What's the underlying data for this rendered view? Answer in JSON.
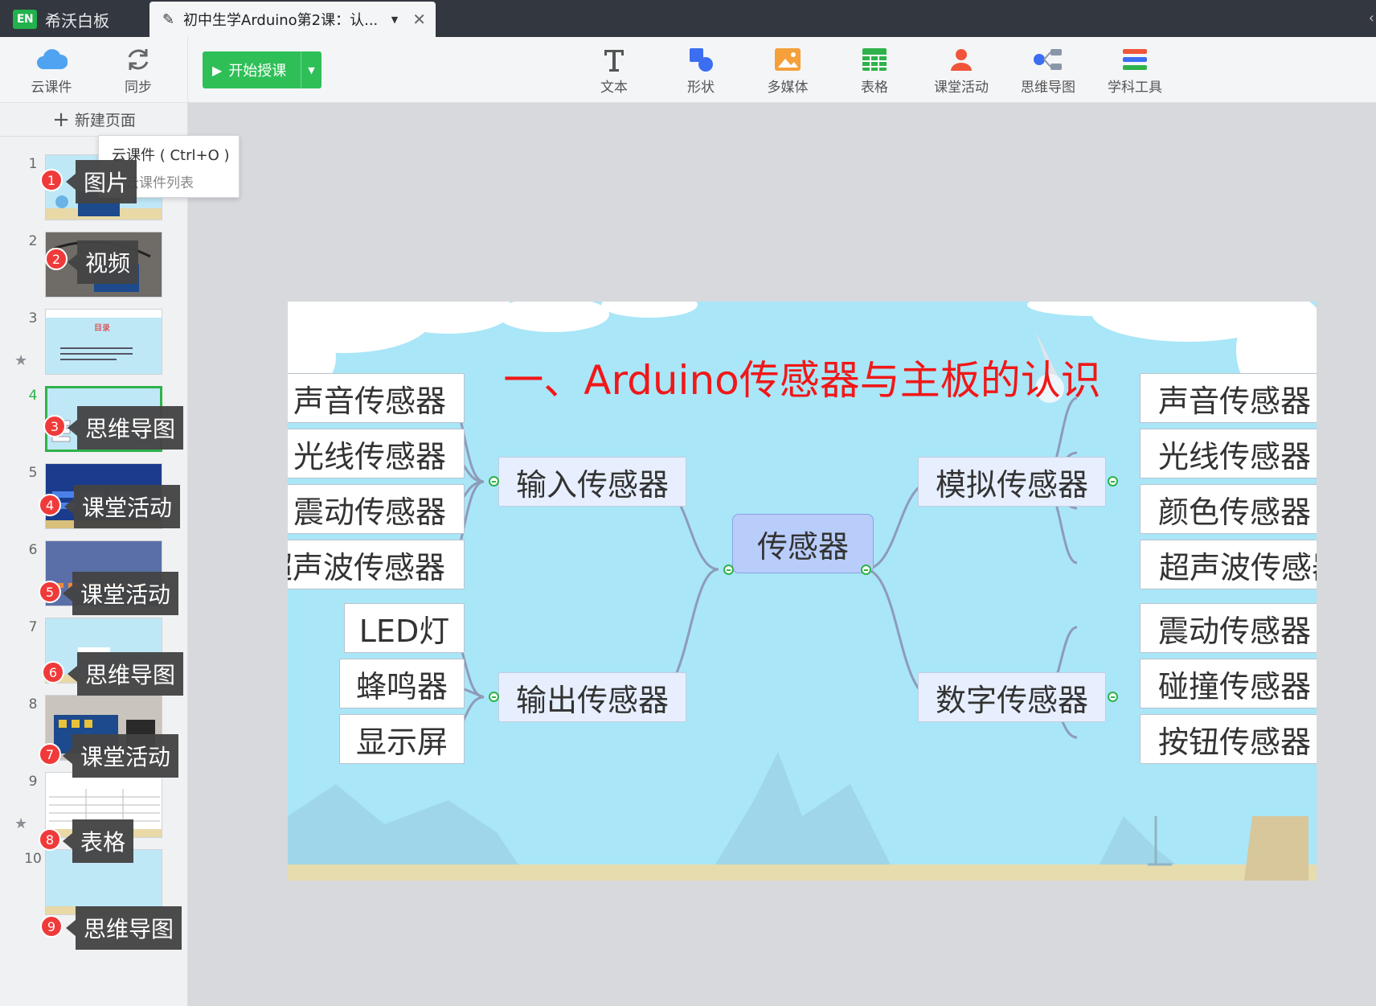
{
  "titlebar": {
    "app_name": "希沃白板",
    "logo_text": "EN",
    "doc_tab_title": "初中生学Arduino第2课：认...",
    "icons": [
      "edit-icon",
      "chevron-down-icon",
      "close-icon"
    ]
  },
  "toolbar": {
    "left": [
      {
        "label": "云课件",
        "icon": "cloud-icon"
      },
      {
        "label": "同步",
        "icon": "sync-icon"
      }
    ],
    "start_button": "开始授课",
    "tools": [
      {
        "label": "文本",
        "icon": "text-icon"
      },
      {
        "label": "形状",
        "icon": "shape-icon"
      },
      {
        "label": "多媒体",
        "icon": "media-icon"
      },
      {
        "label": "表格",
        "icon": "table-icon"
      },
      {
        "label": "课堂活动",
        "icon": "class-activity-icon"
      },
      {
        "label": "思维导图",
        "icon": "mind-map-icon"
      },
      {
        "label": "学科工具",
        "icon": "subject-tools-icon"
      }
    ],
    "colors": {
      "start_green": "#2fbf57",
      "shape_blue": "#3b6ef0",
      "media_orange": "#f5a03a",
      "table_green": "#2fb24b",
      "activity_red": "#f0553a"
    }
  },
  "sidebar": {
    "new_page": "新建页面",
    "tooltip_title": "云课件 ( Ctrl+O )",
    "tooltip_desc": "开云课件列表",
    "pages": [
      {
        "num": "1",
        "badge": "1",
        "label": "图片"
      },
      {
        "num": "2",
        "badge": "2",
        "label": "视频"
      },
      {
        "num": "3",
        "badge": "",
        "label": "",
        "starred": true,
        "thumb_text": "目录"
      },
      {
        "num": "4",
        "badge": "3",
        "label": "思维导图",
        "selected": true
      },
      {
        "num": "5",
        "badge": "4",
        "label": "课堂活动"
      },
      {
        "num": "6",
        "badge": "5",
        "label": "课堂活动"
      },
      {
        "num": "7",
        "badge": "6",
        "label": "思维导图"
      },
      {
        "num": "8",
        "badge": "7",
        "label": "课堂活动"
      },
      {
        "num": "9",
        "badge": "8",
        "label": "表格",
        "starred": true
      },
      {
        "num": "10",
        "badge": "9",
        "label": "思维导图"
      }
    ]
  },
  "slide": {
    "title": "一、Arduino传感器与主板的认识",
    "title_color": "#f01818",
    "mindmap": {
      "root": "传感器",
      "input": {
        "label": "输入传感器",
        "children": [
          "声音传感器",
          "光线传感器",
          "震动传感器",
          "超声波传感器"
        ]
      },
      "output": {
        "label": "输出传感器",
        "children": [
          "LED灯",
          "蜂鸣器",
          "显示屏"
        ]
      },
      "analog": {
        "label": "模拟传感器",
        "children": [
          "声音传感器",
          "光线传感器",
          "颜色传感器",
          "超声波传感器"
        ]
      },
      "digital": {
        "label": "数字传感器",
        "children": [
          "震动传感器",
          "碰撞传感器",
          "按钮传感器"
        ]
      }
    }
  }
}
